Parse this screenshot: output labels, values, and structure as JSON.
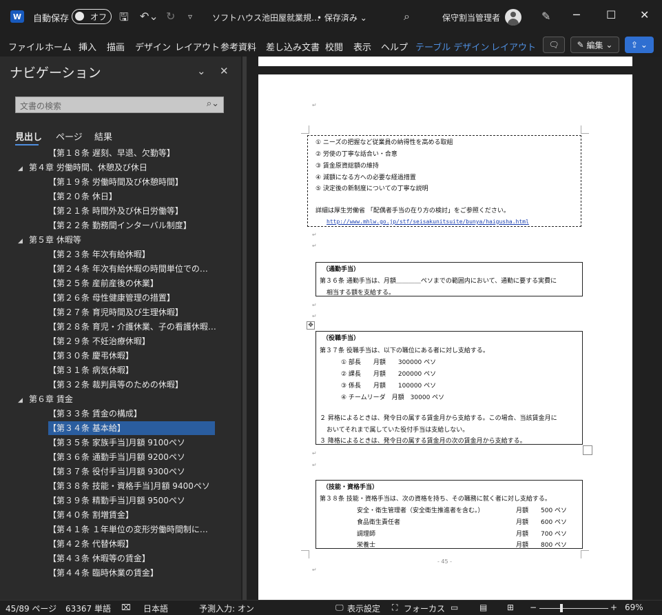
{
  "titlebar": {
    "autosave_label": "自動保存",
    "autosave_state": "オフ",
    "doc_title": "ソフトハウス池田屋就業規…",
    "save_status": "• 保存済み ⌄",
    "user_name": "保守割当管理者",
    "app_letter": "W"
  },
  "ribbon": {
    "tabs": [
      "ファイル",
      "ホーム",
      "挿入",
      "描画",
      "デザイン",
      "レイアウト",
      "参考資料",
      "差し込み文書",
      "校閲",
      "表示",
      "ヘルプ",
      "テーブル デザイン",
      "レイアウト"
    ],
    "edit_label": "編集",
    "accent_color": "#4f8fe0"
  },
  "nav": {
    "title": "ナビゲーション",
    "search_placeholder": "文書の検索",
    "tabs": [
      "見出し",
      "ページ",
      "結果"
    ],
    "items": [
      {
        "label": "【第１８条 遅刻、早退、欠勤等】",
        "level": 2
      },
      {
        "label": "第４章 労働時間、休憩及び休日",
        "level": 1
      },
      {
        "label": "【第１９条 労働時間及び休憩時間】",
        "level": 2
      },
      {
        "label": "【第２０条 休日】",
        "level": 2
      },
      {
        "label": "【第２１条 時間外及び休日労働等】",
        "level": 2
      },
      {
        "label": "【第２２条 勤務間インターバル制度】",
        "level": 2
      },
      {
        "label": "第５章 休暇等",
        "level": 1
      },
      {
        "label": "【第２３条 年次有給休暇】",
        "level": 2
      },
      {
        "label": "【第２４条 年次有給休暇の時間単位での…",
        "level": 2
      },
      {
        "label": "【第２５条 産前産後の休業】",
        "level": 2
      },
      {
        "label": "【第２６条 母性健康管理の措置】",
        "level": 2
      },
      {
        "label": "【第２７条 育児時間及び生理休暇】",
        "level": 2
      },
      {
        "label": "【第２８条 育児・介護休業、子の看護休暇…",
        "level": 2
      },
      {
        "label": "【第２９条 不妊治療休暇】",
        "level": 2
      },
      {
        "label": "【第３０条 慶弔休暇】",
        "level": 2
      },
      {
        "label": "【第３１条 病気休暇】",
        "level": 2
      },
      {
        "label": "【第３２条 裁判員等のための休暇】",
        "level": 2
      },
      {
        "label": "第６章 賃金",
        "level": 1
      },
      {
        "label": "【第３３条 賃金の構成】",
        "level": 2
      },
      {
        "label": "【第３４条 基本給】",
        "level": 2,
        "selected": true
      },
      {
        "label": "【第３５条 家族手当]月額 9100ペソ",
        "level": 2
      },
      {
        "label": "【第３６条 通勤手当]月額 9200ペソ",
        "level": 2
      },
      {
        "label": "【第３７条 役付手当]月額 9300ペソ",
        "level": 2
      },
      {
        "label": "【第３８条 技能・資格手当]月額 9400ペソ",
        "level": 2
      },
      {
        "label": "【第３９条 精勤手当]月額 9500ペソ",
        "level": 2
      },
      {
        "label": "【第４０条 割増賃金】",
        "level": 2
      },
      {
        "label": "【第４１条 １年単位の変形労働時間制に…",
        "level": 2
      },
      {
        "label": "【第４２条 代替休暇】",
        "level": 2
      },
      {
        "label": "【第４３条 休暇等の賃金】",
        "level": 2
      },
      {
        "label": "【第４４条 臨時休業の賃金】",
        "level": 2
      }
    ],
    "selected_color": "#2a5d9f"
  },
  "document": {
    "box1": [
      "① ニーズの把握など従業員の納得性を高める取組",
      "② 労使の丁寧な話合い・合意",
      "③ 賃金原資総額の維持",
      "④ 減額になる方への必要な経過措置",
      "⑤ 決定後の新制度についての丁寧な説明",
      "詳細は厚生労働省 「配偶者手当の在り方の検討」をご参照ください。"
    ],
    "box1_link": "http://www.mhlw.go.jp/stf/seisakunitsuite/bunya/haigusha.html",
    "box2_heading": "（通勤手当）",
    "box2_lines": [
      "第３６条 通勤手当は、月額＿＿＿＿ペソまでの範囲内において、通勤に要する実費に",
      "相当する額を支給する。"
    ],
    "box3_heading": "（役職手当）",
    "box3_lines": [
      "第３７条 役職手当は、以下の職位にある者に対し支給する。",
      "① 部長　　月額　　300000 ペソ",
      "② 課長　　月額　　200000 ペソ",
      "③ 係長　　月額　　100000 ペソ",
      "④ チームリーダ　月額　30000 ペソ",
      "２ 昇格によるときは、発令日の属する賃金月から支給する。この場合、当該賃金月に",
      "おいてそれまで属していた役付手当は支給しない。",
      "３ 降格によるときは、発令日の属する賃金月の次の賃金月から支給する。"
    ],
    "box4_heading": "（技能・資格手当）",
    "box4_lines": [
      "第３８条 技能・資格手当は、次の資格を持ち、その職務に就く者に対し支給する。",
      "安全・衛生管理者（安全衛生推進者を含む。）",
      "食品衛生責任者",
      "調理師",
      "栄養士"
    ],
    "box4_amounts": [
      "月額　　500 ペソ",
      "月額　　600 ペソ",
      "月額　　700 ペソ",
      "月額　　800 ペソ"
    ],
    "page_number": "- 45 -"
  },
  "status": {
    "page": "45/89 ページ",
    "words": "63367 単語",
    "language": "日本語",
    "predict": "予測入力: オン",
    "display_settings": "表示設定",
    "focus": "フォーカス",
    "zoom": "69%"
  }
}
